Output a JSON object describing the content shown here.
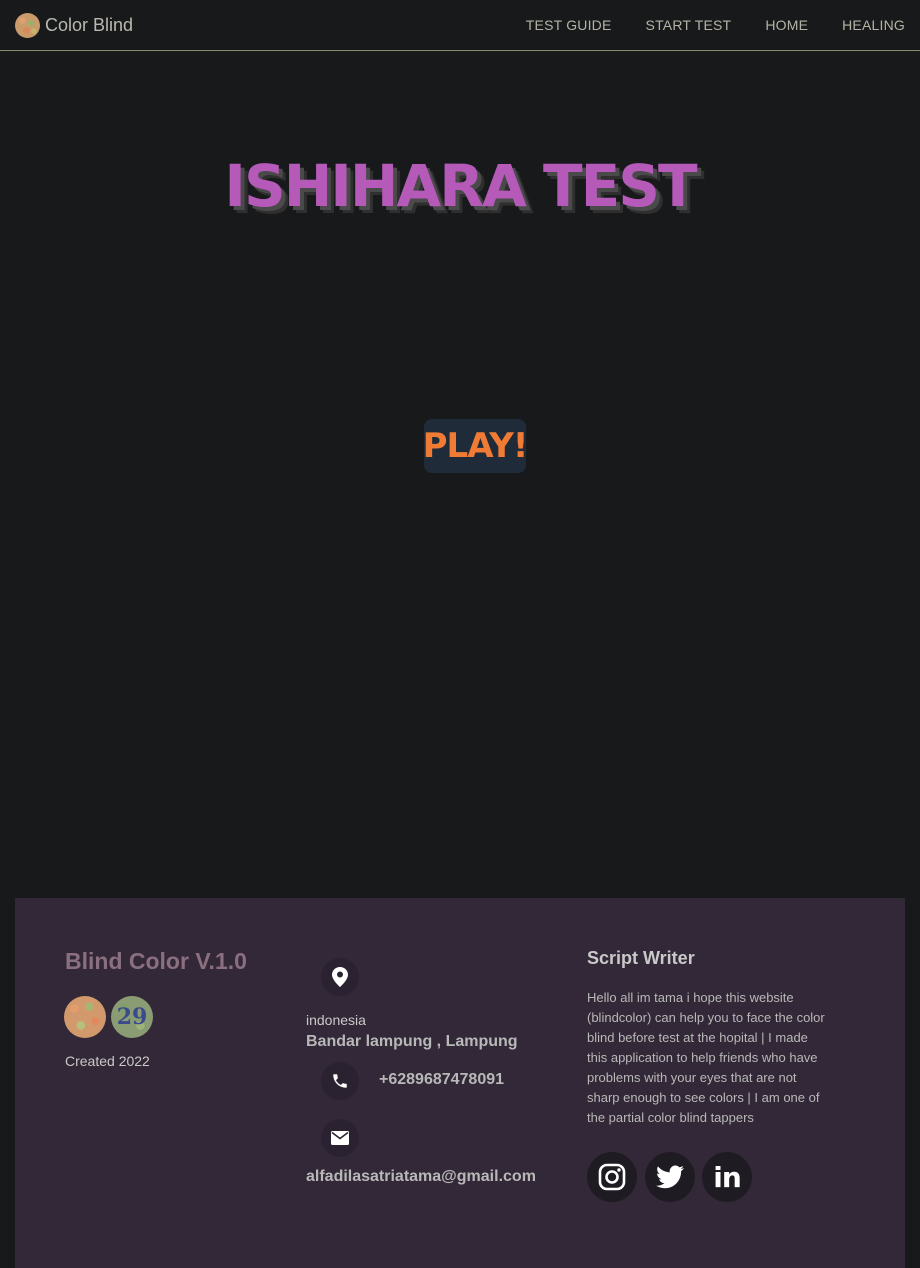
{
  "navbar": {
    "brand": "Color Blind",
    "links": [
      "TEST GUIDE",
      "START TEST",
      "HOME",
      "HEALING"
    ]
  },
  "hero": {
    "title": "ISHIHARA TEST",
    "play_label": "PLAY!"
  },
  "footer": {
    "title": "Blind Color V.1.0",
    "plate_number": "29",
    "created": "Created 2022",
    "country": "indonesia",
    "city": "Bandar lampung , Lampung",
    "phone": "+6289687478091",
    "email": "alfadilasatriatama@gmail.com",
    "writer_title": "Script Writer",
    "writer_text": "Hello all im tama i hope this website (blindcolor) can help you to face the color blind before test at the hopital | I made this application to help friends who have problems with your eyes that are not sharp enough to see colors | I am one of the partial color blind tappers",
    "social": [
      "instagram-icon",
      "twitter-icon",
      "linkedin-icon"
    ]
  },
  "colors": {
    "background": "#18191b",
    "title": "#b55ab8",
    "play": "#f07b35",
    "play_bg": "#1f2b38",
    "footer_bg": "#332837"
  }
}
